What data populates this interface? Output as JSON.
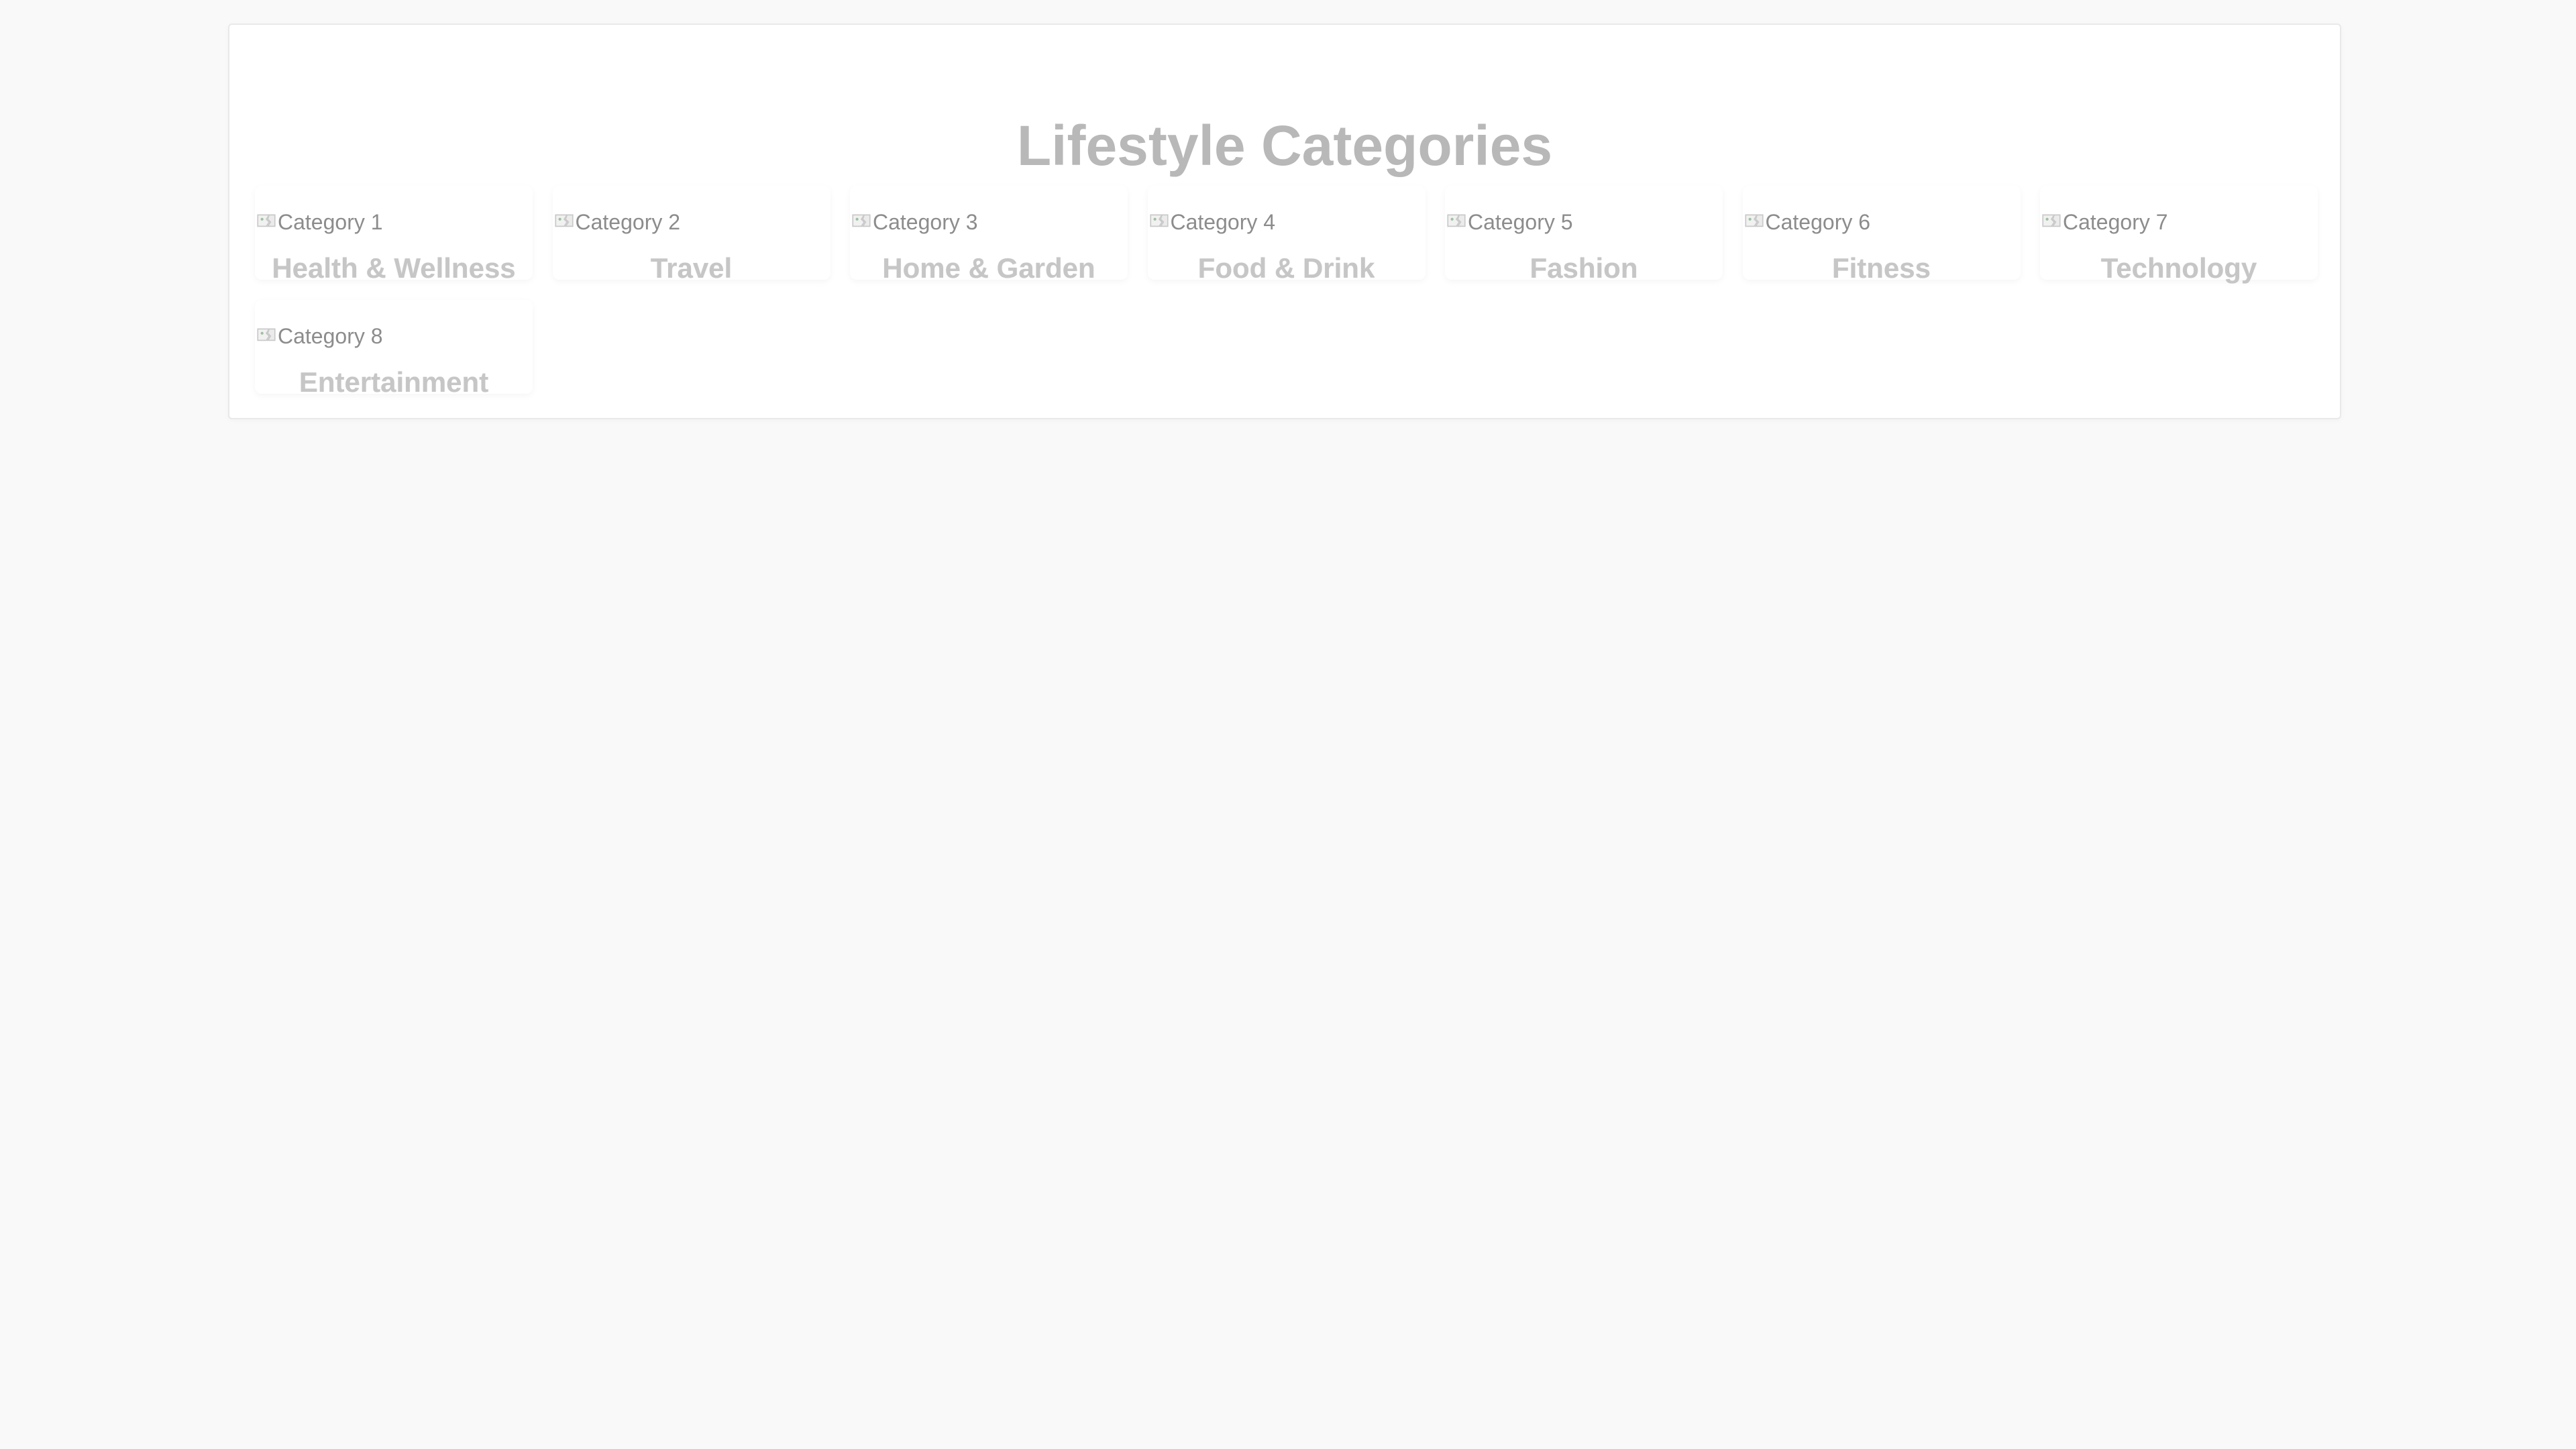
{
  "page": {
    "title": "Lifestyle Categories"
  },
  "categories": [
    {
      "alt": "Category 1",
      "label": "Health & Wellness"
    },
    {
      "alt": "Category 2",
      "label": "Travel"
    },
    {
      "alt": "Category 3",
      "label": "Home & Garden"
    },
    {
      "alt": "Category 4",
      "label": "Food & Drink"
    },
    {
      "alt": "Category 5",
      "label": "Fashion"
    },
    {
      "alt": "Category 6",
      "label": "Fitness"
    },
    {
      "alt": "Category 7",
      "label": "Technology"
    },
    {
      "alt": "Category 8",
      "label": "Entertainment"
    }
  ],
  "icons": {
    "category_image": "broken-image-icon"
  },
  "colors": {
    "background": "#f9f9f9",
    "panel": "#ffffff",
    "title": "#b8b8b8",
    "label": "#c6c6c6",
    "alt_text": "#8c8c8c"
  }
}
